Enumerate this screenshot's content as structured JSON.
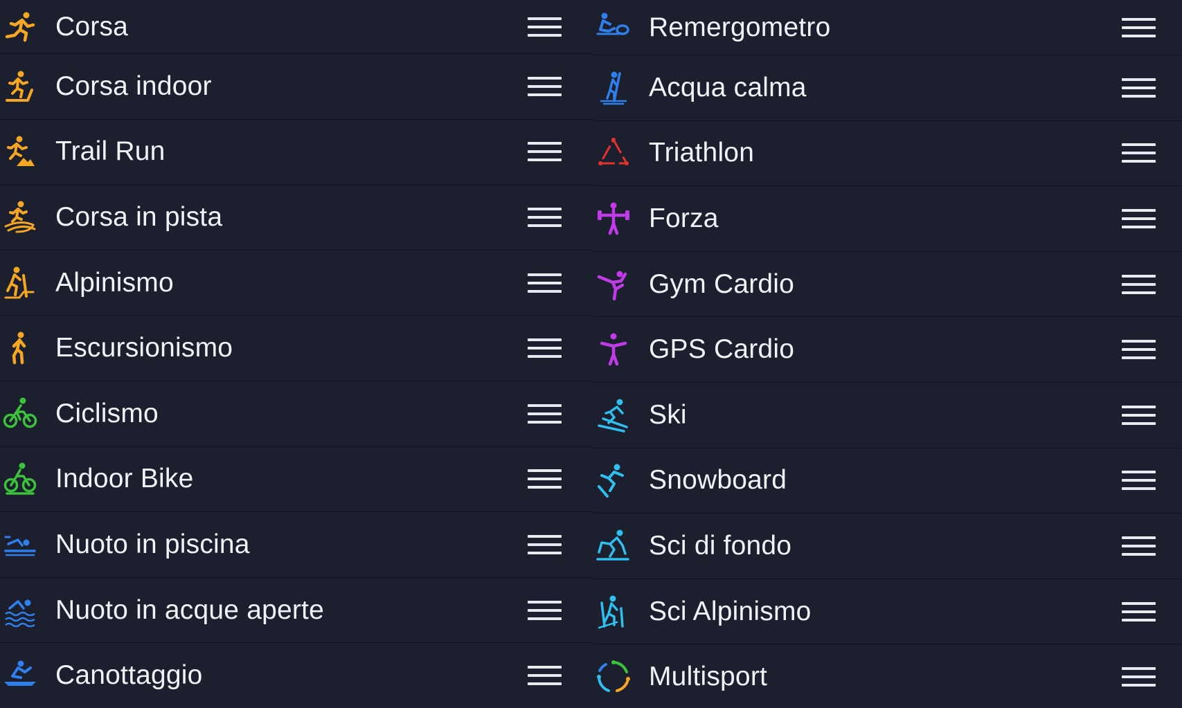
{
  "colors": {
    "background": "#1b1f2e",
    "divider": "#101320",
    "text": "#f2f3f7",
    "run_orange": "#f5a623",
    "bike_green": "#3bc43b",
    "water_blue": "#2f80ed",
    "triathlon_red": "#e5322d",
    "gym_purple": "#c23be8",
    "snow_cyan": "#2fc0f0"
  },
  "left_column": [
    {
      "label": "Corsa",
      "icon": "running-icon",
      "color": "#f5a623"
    },
    {
      "label": "Corsa indoor",
      "icon": "treadmill-icon",
      "color": "#f5a623"
    },
    {
      "label": "Trail Run",
      "icon": "trail-run-icon",
      "color": "#f5a623"
    },
    {
      "label": "Corsa in pista",
      "icon": "track-run-icon",
      "color": "#f5a623"
    },
    {
      "label": "Alpinismo",
      "icon": "mountaineering-icon",
      "color": "#f5a623"
    },
    {
      "label": "Escursionismo",
      "icon": "hiking-icon",
      "color": "#f5a623"
    },
    {
      "label": "Ciclismo",
      "icon": "cycling-icon",
      "color": "#3bc43b"
    },
    {
      "label": "Indoor Bike",
      "icon": "indoor-bike-icon",
      "color": "#3bc43b"
    },
    {
      "label": "Nuoto in piscina",
      "icon": "pool-swim-icon",
      "color": "#2f80ed"
    },
    {
      "label": "Nuoto in acque aperte",
      "icon": "open-water-swim-icon",
      "color": "#2f80ed"
    },
    {
      "label": "Canottaggio",
      "icon": "rowing-icon",
      "color": "#2f80ed"
    }
  ],
  "right_column": [
    {
      "label": "Remergometro",
      "icon": "rowing-machine-icon",
      "color": "#2f80ed"
    },
    {
      "label": "Acqua calma",
      "icon": "paddle-icon",
      "color": "#2f80ed"
    },
    {
      "label": "Triathlon",
      "icon": "triathlon-icon",
      "color": "#e5322d"
    },
    {
      "label": "Forza",
      "icon": "strength-icon",
      "color": "#c23be8"
    },
    {
      "label": "Gym Cardio",
      "icon": "gym-cardio-icon",
      "color": "#c23be8"
    },
    {
      "label": "GPS Cardio",
      "icon": "gps-cardio-icon",
      "color": "#c23be8"
    },
    {
      "label": "Ski",
      "icon": "ski-icon",
      "color": "#2fc0f0"
    },
    {
      "label": "Snowboard",
      "icon": "snowboard-icon",
      "color": "#2fc0f0"
    },
    {
      "label": "Sci di fondo",
      "icon": "cross-country-ski-icon",
      "color": "#2fc0f0"
    },
    {
      "label": "Sci Alpinismo",
      "icon": "ski-touring-icon",
      "color": "#2fc0f0"
    },
    {
      "label": "Multisport",
      "icon": "multisport-icon",
      "color": "#2fc0f0"
    }
  ],
  "drag_handle_icon": "drag-handle-icon"
}
